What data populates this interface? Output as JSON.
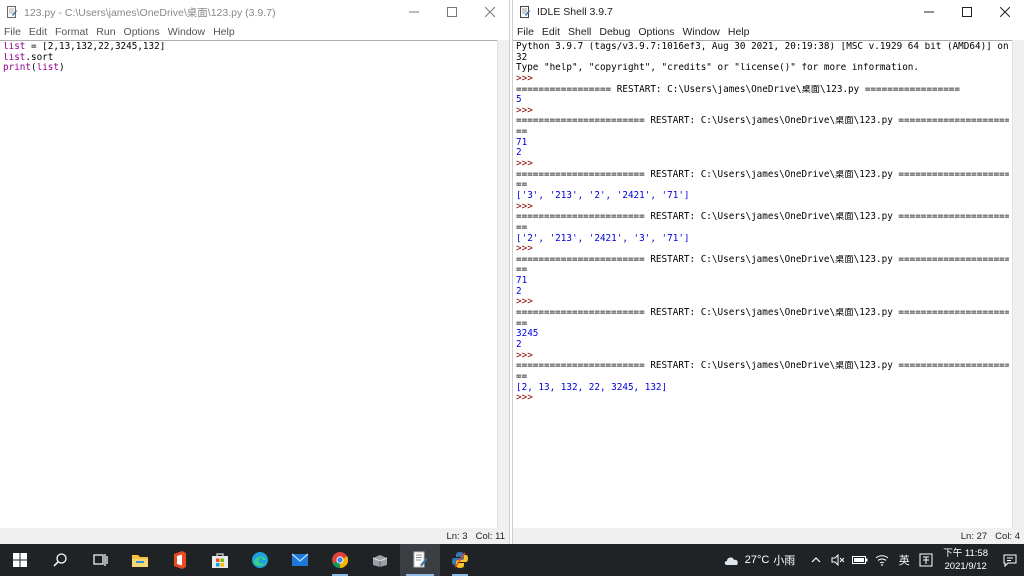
{
  "editor_window": {
    "title": "123.py - C:\\Users\\james\\OneDrive\\桌面\\123.py (3.9.7)",
    "menu": [
      "File",
      "Edit",
      "Format",
      "Run",
      "Options",
      "Window",
      "Help"
    ],
    "code_lines": [
      [
        {
          "t": "list",
          "c": "builtin"
        },
        {
          "t": " = [2,13,132,22,3245,132]",
          "c": "normal"
        }
      ],
      [
        {
          "t": "list",
          "c": "builtin"
        },
        {
          "t": ".sort",
          "c": "normal"
        }
      ],
      [
        {
          "t": "print",
          "c": "builtin"
        },
        {
          "t": "(",
          "c": "normal"
        },
        {
          "t": "list",
          "c": "builtin"
        },
        {
          "t": ")",
          "c": "normal"
        }
      ]
    ],
    "status": {
      "ln": "Ln: 3",
      "col": "Col: 11"
    }
  },
  "shell_window": {
    "title": "IDLE Shell 3.9.7",
    "menu": [
      "File",
      "Edit",
      "Shell",
      "Debug",
      "Options",
      "Window",
      "Help"
    ],
    "lines": [
      {
        "t": "Python 3.9.7 (tags/v3.9.7:1016ef3, Aug 30 2021, 20:19:38) [MSC v.1929 64 bit (AMD64)] on win",
        "c": "normal"
      },
      {
        "t": "32",
        "c": "normal"
      },
      {
        "t": "Type \"help\", \"copyright\", \"credits\" or \"license()\" for more information.",
        "c": "normal"
      },
      {
        "t": ">>>",
        "c": "prompt"
      },
      {
        "t": "================= RESTART: C:\\Users\\james\\OneDrive\\桌面\\123.py =================",
        "c": "restart"
      },
      {
        "t": "5",
        "c": "out"
      },
      {
        "t": ">>>",
        "c": "prompt"
      },
      {
        "t": "======================= RESTART: C:\\Users\\james\\OneDrive\\桌面\\123.py =======================",
        "c": "restart"
      },
      {
        "t": "==",
        "c": "restart"
      },
      {
        "t": "71",
        "c": "out"
      },
      {
        "t": "2",
        "c": "out"
      },
      {
        "t": ">>>",
        "c": "prompt"
      },
      {
        "t": "======================= RESTART: C:\\Users\\james\\OneDrive\\桌面\\123.py =======================",
        "c": "restart"
      },
      {
        "t": "==",
        "c": "restart"
      },
      {
        "t": "['3', '213', '2', '2421', '71']",
        "c": "out"
      },
      {
        "t": ">>>",
        "c": "prompt"
      },
      {
        "t": "======================= RESTART: C:\\Users\\james\\OneDrive\\桌面\\123.py =======================",
        "c": "restart"
      },
      {
        "t": "==",
        "c": "restart"
      },
      {
        "t": "['2', '213', '2421', '3', '71']",
        "c": "out"
      },
      {
        "t": ">>>",
        "c": "prompt"
      },
      {
        "t": "======================= RESTART: C:\\Users\\james\\OneDrive\\桌面\\123.py =======================",
        "c": "restart"
      },
      {
        "t": "==",
        "c": "restart"
      },
      {
        "t": "71",
        "c": "out"
      },
      {
        "t": "2",
        "c": "out"
      },
      {
        "t": ">>>",
        "c": "prompt"
      },
      {
        "t": "======================= RESTART: C:\\Users\\james\\OneDrive\\桌面\\123.py =======================",
        "c": "restart"
      },
      {
        "t": "==",
        "c": "restart"
      },
      {
        "t": "3245",
        "c": "out"
      },
      {
        "t": "2",
        "c": "out"
      },
      {
        "t": ">>>",
        "c": "prompt"
      },
      {
        "t": "======================= RESTART: C:\\Users\\james\\OneDrive\\桌面\\123.py =======================",
        "c": "restart"
      },
      {
        "t": "==",
        "c": "restart"
      },
      {
        "t": "[2, 13, 132, 22, 3245, 132]",
        "c": "out"
      },
      {
        "t": ">>>",
        "c": "prompt"
      }
    ],
    "status": {
      "ln": "Ln: 27",
      "col": "Col: 4"
    }
  },
  "taskbar": {
    "apps": [
      "start-icon",
      "search-icon",
      "task-view-icon",
      "file-explorer-icon",
      "office-icon",
      "store-icon",
      "edge-icon",
      "mail-icon",
      "chrome-icon",
      "app-icon",
      "idle-editor-icon",
      "python-icon"
    ],
    "weather": {
      "temp": "27°C",
      "condition": "小雨"
    },
    "ime": "英",
    "time": "下午 11:58",
    "date": "2021/9/12"
  },
  "colors": {
    "builtin": "#900090",
    "output": "#0000e0",
    "prompt": "#8b0000",
    "taskbar": "#202326"
  }
}
